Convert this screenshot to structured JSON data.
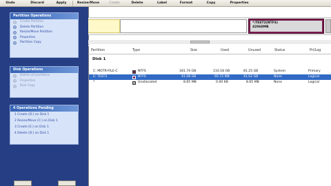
{
  "toolbar": {
    "buttons": [
      {
        "label": "Undo",
        "enabled": true
      },
      {
        "label": "Discard",
        "enabled": true
      },
      {
        "label": "Apply",
        "enabled": true
      },
      {
        "label": "Resize/Move",
        "enabled": true
      },
      {
        "label": "Create",
        "enabled": false
      },
      {
        "label": "Delete",
        "enabled": true
      },
      {
        "label": "Label",
        "enabled": true
      },
      {
        "label": "Format",
        "enabled": true
      },
      {
        "label": "Copy",
        "enabled": true
      },
      {
        "label": "Properties",
        "enabled": true
      }
    ]
  },
  "partition_operations": {
    "title": "Partition Operations",
    "items": [
      {
        "label": "Create Partition",
        "enabled": false
      },
      {
        "label": "Delete Partition",
        "enabled": true
      },
      {
        "label": "Resize/Move Partition",
        "enabled": true
      },
      {
        "label": "Properties",
        "enabled": true
      },
      {
        "label": "Partition Copy",
        "enabled": true
      }
    ]
  },
  "disk_operations": {
    "title": "Disk Operations",
    "items": [
      {
        "label": "Delete all partitions",
        "enabled": false
      },
      {
        "label": "Properties",
        "enabled": false
      },
      {
        "label": "Disk Copy",
        "enabled": false
      }
    ]
  },
  "pending": {
    "title": "4 Operations Pending",
    "items": [
      "1 Create (D:) on Disk 1",
      "2 Resize/Move (C:) on Disk 1",
      "3 Create (E:) on Disk 1",
      "4 Delete (D:) on Disk 1"
    ]
  },
  "diskmap": {
    "selected_name": "*:TEST2(NTFS)",
    "selected_size": "42068MB"
  },
  "table": {
    "headers": [
      "Partition",
      "Type",
      "Size",
      "Used",
      "Unused",
      "Status",
      "Pri/Log"
    ],
    "disk_label": "Disk 1",
    "rows": [
      {
        "partition": "C: MOTR-FILE-C",
        "type": "NTFS",
        "size": "181.74 GB",
        "used": "110.18 GB",
        "unused": "81.25 GB",
        "status": "System",
        "prilog": "Primary",
        "swatch": "#7b2a5a",
        "selected": false
      },
      {
        "partition": "E: TEST2",
        "type": "NTFS",
        "size": "41.08 GB",
        "used": "65.72 MB",
        "unused": "41.02 GB",
        "status": "None",
        "prilog": "Logical",
        "swatch": "#7b2a5a",
        "selected": true
      },
      {
        "partition": "*",
        "type": "Unallocated",
        "size": "8.65 MB",
        "used": "0.00 KB",
        "unused": "8.65 MB",
        "status": "None",
        "prilog": "Logical",
        "swatch": "#b0b0b0",
        "selected": false
      }
    ]
  },
  "colors": {
    "frame": "#253e84",
    "selection": "#316ac5",
    "ntfs": "#7b2a5a",
    "panel": "#d7e3f8"
  }
}
